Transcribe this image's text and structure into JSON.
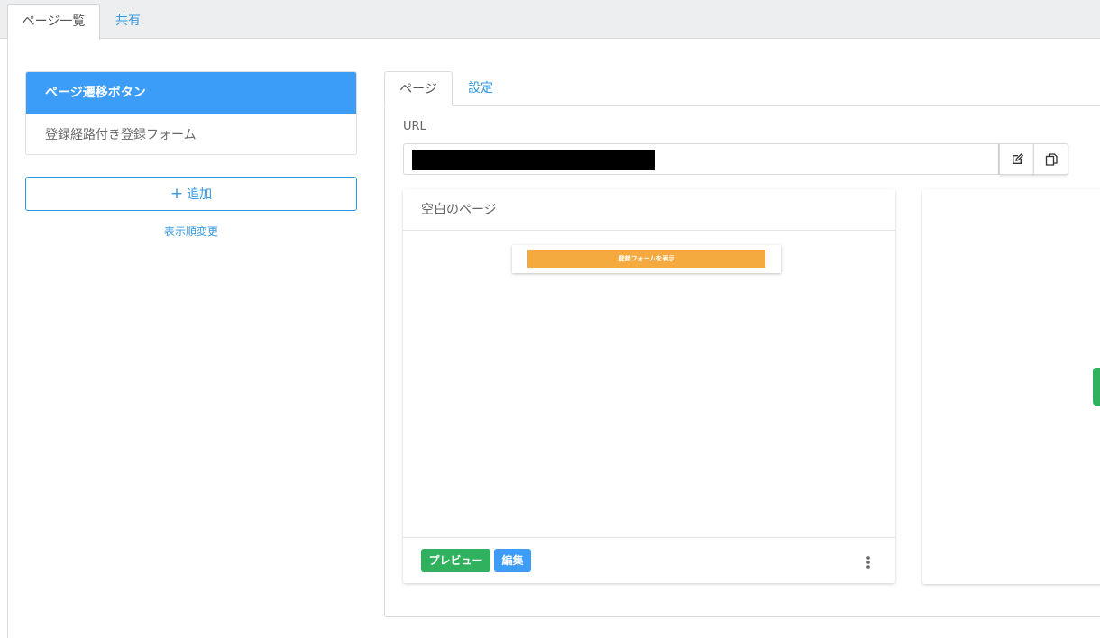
{
  "top_tabs": [
    {
      "label": "ページ一覧",
      "active": true
    },
    {
      "label": "共有",
      "active": false
    }
  ],
  "page_list": [
    {
      "label": "ページ遷移ボタン",
      "selected": true
    },
    {
      "label": "登録経路付き登録フォーム",
      "selected": false
    }
  ],
  "add_button": {
    "icon": "+",
    "label": "追加"
  },
  "sort_link": "表示順変更",
  "inner_tabs": [
    {
      "label": "ページ",
      "active": true
    },
    {
      "label": "設定",
      "active": false
    }
  ],
  "url_section": {
    "label": "URL",
    "value": "(redacted)",
    "edit_icon": "edit-icon",
    "copy_icon": "copy-icon"
  },
  "card": {
    "title": "空白のページ",
    "thumbnail_button_label": "登録フォームを表示",
    "preview_label": "プレビュー",
    "edit_label": "編集",
    "more_icon": "more-vertical-icon"
  },
  "colors": {
    "primary": "#3c9df8",
    "link": "#3399e0",
    "success": "#2fb15e",
    "thumb_orange": "#f4aa3f"
  }
}
